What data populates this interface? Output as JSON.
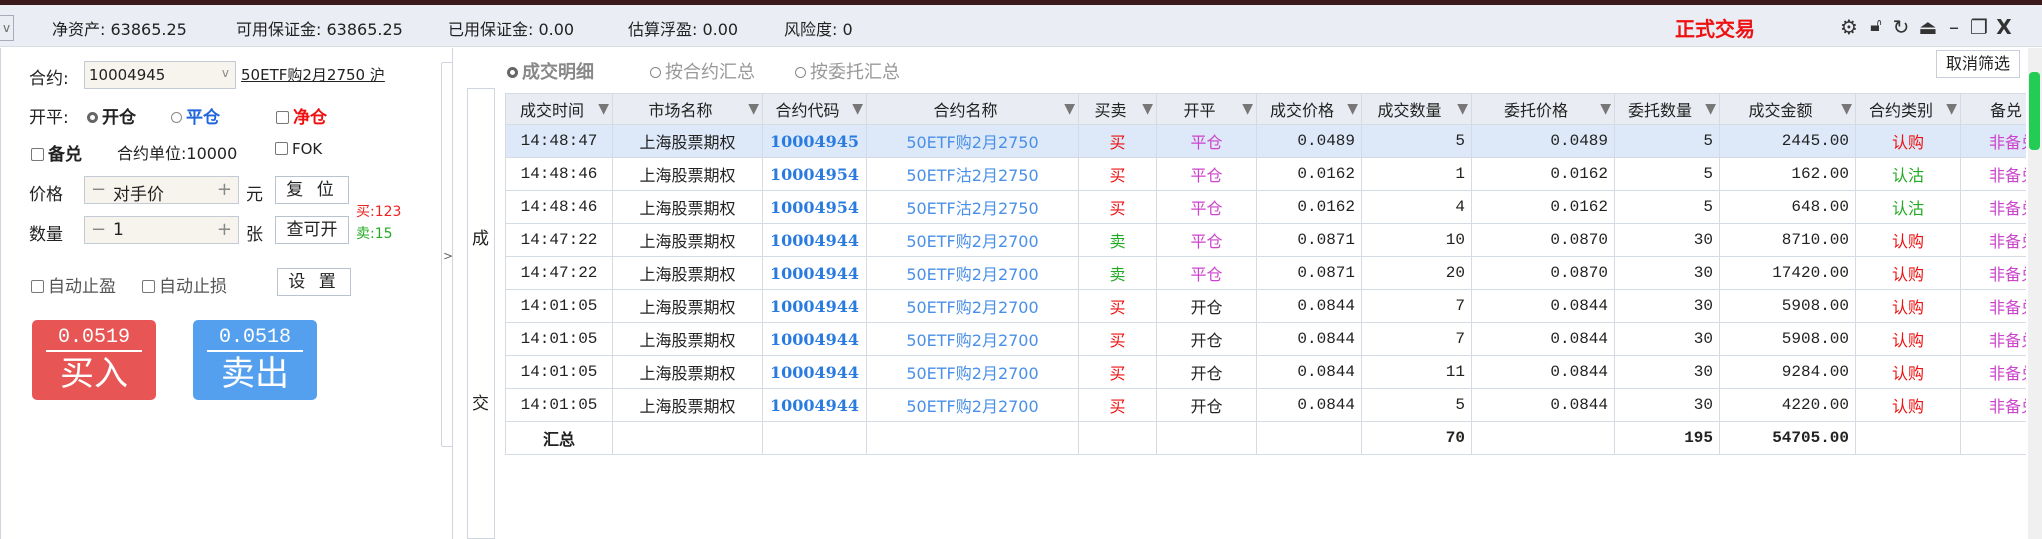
{
  "topbar": {
    "net_assets": "净资产: 63865.25",
    "available_margin": "可用保证金: 63865.25",
    "used_margin": "已用保证金: 0.00",
    "est_float_pnl": "估算浮盈: 0.00",
    "risk": "风险度: 0",
    "mode": "正式交易",
    "mode_color": "#ee1111",
    "icons": [
      "gear-icon",
      "lock-icon",
      "refresh-icon",
      "eject-icon",
      "minimize-icon",
      "restore-icon",
      "close-icon"
    ]
  },
  "order": {
    "contract_label": "合约:",
    "contract_value": "10004945",
    "contract_name": "50ETF购2月2750 沪",
    "openclose_label": "开平:",
    "open": "开仓",
    "close": "平仓",
    "net": "净仓",
    "covered": "备兑",
    "unit": "合约单位:10000",
    "fok": "FOK",
    "price_label": "价格",
    "price_value": "对手价",
    "price_unit": "元",
    "reset": "复 位",
    "qty_label": "数量",
    "qty_value": "1",
    "qty_unit": "张",
    "query": "查可开",
    "buy_avail": "买:123",
    "sell_avail": "卖:15",
    "auto_tp": "自动止盈",
    "auto_sl": "自动止损",
    "settings": "设 置",
    "buy_price": "0.0519",
    "buy_label": "买入",
    "sell_price": "0.0518",
    "sell_label": "卖出",
    "buy_color": "#e85555",
    "sell_color": "#55a0ee"
  },
  "collapse": ">",
  "vtab": {
    "c1": "成",
    "c2": "交"
  },
  "view": {
    "detail": "成交明细",
    "by_contract": "按合约汇总",
    "by_order": "按委托汇总",
    "cancel_filter": "取消筛选"
  },
  "table": {
    "headers": [
      "成交时间",
      "市场名称",
      "合约代码",
      "合约名称",
      "买卖",
      "开平",
      "成交价格",
      "成交数量",
      "委托价格",
      "委托数量",
      "成交金额",
      "合约类别",
      "备兑"
    ],
    "rows": [
      [
        "14:48:47",
        "上海股票期权",
        "10004945",
        "50ETF购2月2750",
        "买",
        "平仓",
        "0.0489",
        "5",
        "0.0489",
        "5",
        "2445.00",
        "认购",
        "非备兑"
      ],
      [
        "14:48:46",
        "上海股票期权",
        "10004954",
        "50ETF沽2月2750",
        "买",
        "平仓",
        "0.0162",
        "1",
        "0.0162",
        "5",
        "162.00",
        "认沽",
        "非备兑"
      ],
      [
        "14:48:46",
        "上海股票期权",
        "10004954",
        "50ETF沽2月2750",
        "买",
        "平仓",
        "0.0162",
        "4",
        "0.0162",
        "5",
        "648.00",
        "认沽",
        "非备兑"
      ],
      [
        "14:47:22",
        "上海股票期权",
        "10004944",
        "50ETF购2月2700",
        "卖",
        "平仓",
        "0.0871",
        "10",
        "0.0870",
        "30",
        "8710.00",
        "认购",
        "非备兑"
      ],
      [
        "14:47:22",
        "上海股票期权",
        "10004944",
        "50ETF购2月2700",
        "卖",
        "平仓",
        "0.0871",
        "20",
        "0.0870",
        "30",
        "17420.00",
        "认购",
        "非备兑"
      ],
      [
        "14:01:05",
        "上海股票期权",
        "10004944",
        "50ETF购2月2700",
        "买",
        "开仓",
        "0.0844",
        "7",
        "0.0844",
        "30",
        "5908.00",
        "认购",
        "非备兑"
      ],
      [
        "14:01:05",
        "上海股票期权",
        "10004944",
        "50ETF购2月2700",
        "买",
        "开仓",
        "0.0844",
        "7",
        "0.0844",
        "30",
        "5908.00",
        "认购",
        "非备兑"
      ],
      [
        "14:01:05",
        "上海股票期权",
        "10004944",
        "50ETF购2月2700",
        "买",
        "开仓",
        "0.0844",
        "11",
        "0.0844",
        "30",
        "9284.00",
        "认购",
        "非备兑"
      ],
      [
        "14:01:05",
        "上海股票期权",
        "10004944",
        "50ETF购2月2700",
        "买",
        "开仓",
        "0.0844",
        "5",
        "0.0844",
        "30",
        "4220.00",
        "认购",
        "非备兑"
      ]
    ],
    "summary": {
      "label": "汇总",
      "trade_qty": "70",
      "order_qty": "195",
      "amount": "54705.00"
    }
  }
}
